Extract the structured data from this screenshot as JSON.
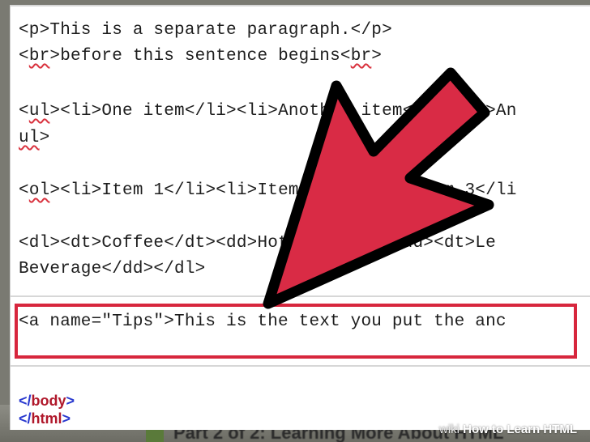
{
  "code_lines": [
    {
      "text": "<p>This is a separate paragraph.</p>"
    },
    {
      "pre": "<",
      "sq": "br",
      "post": ">before this sentence begins<",
      "sq2": "br",
      "post2": ">"
    },
    {
      "pre": "<",
      "sq": "ul",
      "post": "><li>One item</li><li>Another item</li><li>An"
    },
    {
      "sq": "ul",
      "post": ">"
    },
    {
      "pre": "<",
      "sq": "ol",
      "post": "><li>Item 1</li><li>Item 2</li><li>Item 3</li"
    },
    {
      "text": "<dl><dt>Coffee</dt><dd>Hot beverage</dd><dt>Le"
    },
    {
      "text": "Beverage</dd></dl>"
    },
    {
      "text": "<a name=\"Tips\">This is the text you put the anc"
    }
  ],
  "closing_tags": [
    {
      "open": "</",
      "tag": "body",
      "close": ">"
    },
    {
      "open": "</",
      "tag": "html",
      "close": ">"
    }
  ],
  "backdrop": {
    "heading": "Part 2 of 2: Learning More About HTML"
  },
  "watermark": {
    "prefix": "wiki",
    "title": "How to Learn HTML"
  },
  "colors": {
    "arrow_fill": "#d92b45",
    "arrow_stroke": "#000000",
    "highlight_border": "#d7263d",
    "tag_blue": "#2a3acf",
    "tag_red": "#b0182b"
  },
  "icons": {
    "pointer": "arrow-icon"
  }
}
